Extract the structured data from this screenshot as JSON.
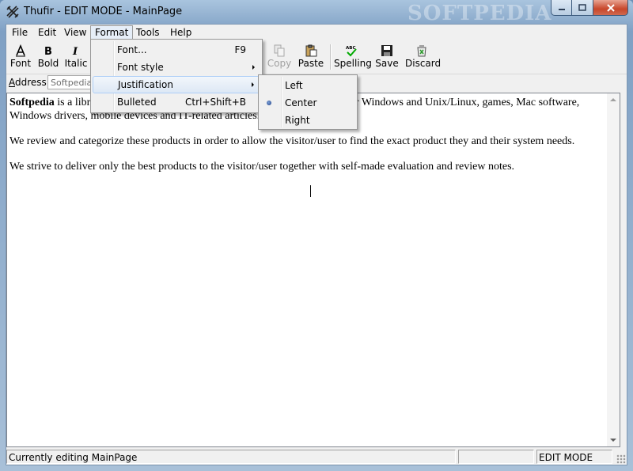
{
  "window": {
    "title": "Thufir - EDIT MODE - MainPage",
    "watermark": "SOFTPEDIA"
  },
  "menubar": {
    "items": [
      "File",
      "Edit",
      "View",
      "Format",
      "Tools",
      "Help"
    ],
    "active": "Format"
  },
  "toolbar": {
    "font": "Font",
    "bold": "Bold",
    "italic": "Italic",
    "copy": "Copy",
    "paste": "Paste",
    "spelling": "Spelling",
    "save": "Save",
    "discard": "Discard"
  },
  "address": {
    "label_accel": "A",
    "label_rest": "ddress",
    "value": "Softpedia"
  },
  "document": {
    "p1_bold": "Softpedia",
    "p1_rest_a": " is a libr",
    "p1_rest_b": "ns for Windows and Unix/Linux, games, Mac software,",
    "p1_line2": "Windows drivers, mobile devices and IT-related articles.",
    "p2": "We review and categorize these products in order to allow the visitor/user to find the exact product they and their system needs.",
    "p3": "We strive to deliver only the best products to the visitor/user together with self-made evaluation and review notes."
  },
  "format_menu": {
    "items": [
      {
        "label": "Font...",
        "shortcut": "F9"
      },
      {
        "label": "Font style",
        "shortcut": ""
      },
      {
        "label": "Justification",
        "shortcut": ""
      },
      {
        "label": "Bulleted",
        "shortcut": "Ctrl+Shift+B"
      }
    ]
  },
  "justification_menu": {
    "items": [
      "Left",
      "Center",
      "Right"
    ],
    "checked": "Center"
  },
  "statusbar": {
    "message": "Currently editing MainPage",
    "middle": "",
    "mode": "EDIT MODE"
  },
  "colors": {
    "menu_highlight_border": "#aecff7",
    "radio_dot": "#1e3f86",
    "close_button": "#c7462a"
  }
}
